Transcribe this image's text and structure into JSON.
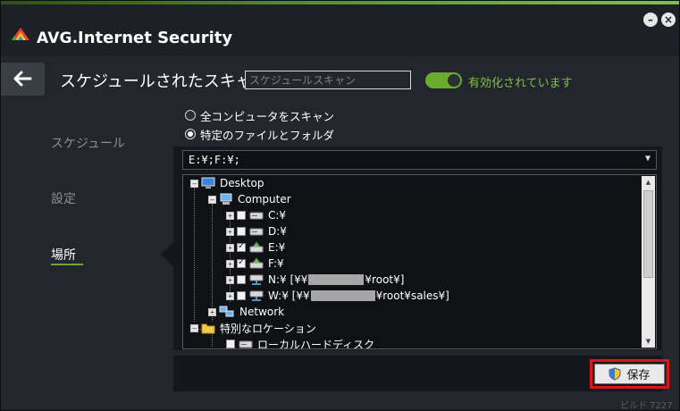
{
  "app": {
    "brand": "AVG.",
    "product": "Internet Security",
    "minimize_label": "–",
    "close_label": "×"
  },
  "header": {
    "title": "スケジュールされたスキャン",
    "name_placeholder": "スケジュールスキャン",
    "toggle_on": true,
    "toggle_label": "有効化されています"
  },
  "sidebar": {
    "items": [
      {
        "label": "スケジュール",
        "active": false
      },
      {
        "label": "設定",
        "active": false
      },
      {
        "label": "場所",
        "active": true
      }
    ]
  },
  "scan_options": {
    "options": [
      {
        "label": "全コンピュータをスキャン",
        "selected": false
      },
      {
        "label": "特定のファイルとフォルダ",
        "selected": true
      }
    ]
  },
  "path_field": {
    "value": "E:¥;F:¥;"
  },
  "tree": {
    "desktop": "Desktop",
    "computer": "Computer",
    "drives": [
      {
        "label": "C:¥",
        "checked": false
      },
      {
        "label": "D:¥",
        "checked": false
      },
      {
        "label": "E:¥",
        "checked": true
      },
      {
        "label": "F:¥",
        "checked": true
      },
      {
        "label_pre": "N:¥  [¥¥",
        "label_post": "¥root¥]",
        "checked": false
      },
      {
        "label_pre": "W:¥  [¥¥",
        "label_post": "¥root¥sales¥]",
        "checked": false
      }
    ],
    "network": "Network",
    "special_locations": "特別なロケーション",
    "local_hdd": "ローカルハードディスク"
  },
  "footer": {
    "save_label": "保存",
    "build": "ビルド 7227"
  }
}
